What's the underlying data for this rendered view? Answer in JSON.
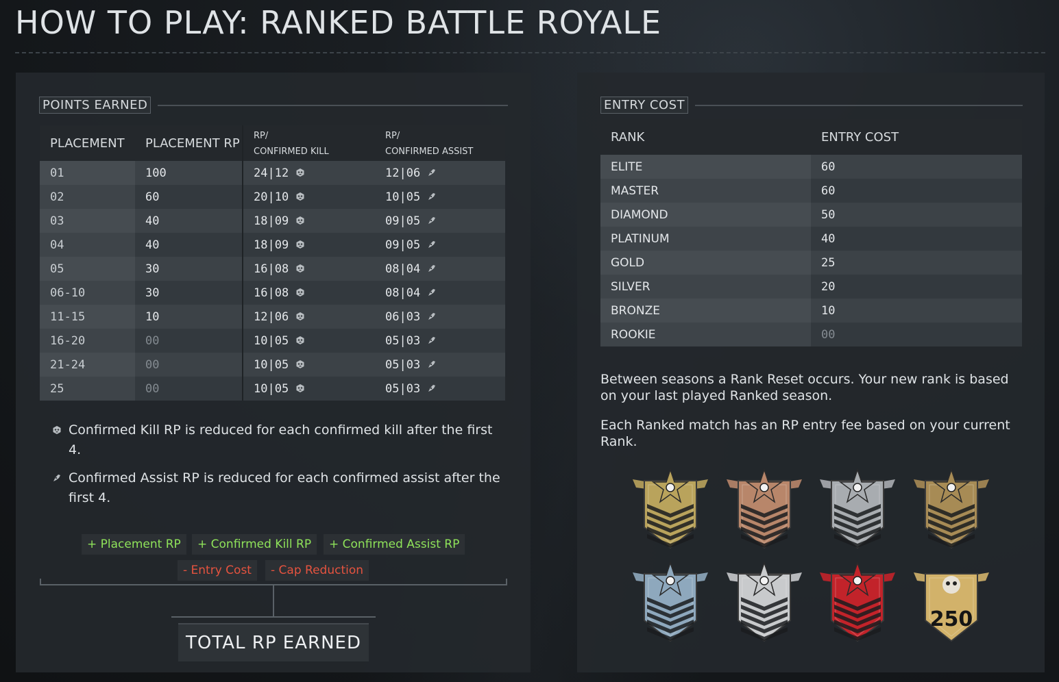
{
  "title": "HOW TO PLAY: RANKED BATTLE ROYALE",
  "points": {
    "section_label": "POINTS EARNED",
    "headers": {
      "placement": "PLACEMENT",
      "placement_rp": "PLACEMENT RP",
      "kill_top": "RP/",
      "kill_bottom": "CONFIRMED KILL",
      "assist_top": "RP/",
      "assist_bottom": "CONFIRMED ASSIST"
    },
    "rows": [
      {
        "placement": "01",
        "rp": "100",
        "kill": "24|12",
        "assist": "12|06"
      },
      {
        "placement": "02",
        "rp": "60",
        "kill": "20|10",
        "assist": "10|05"
      },
      {
        "placement": "03",
        "rp": "40",
        "kill": "18|09",
        "assist": "09|05"
      },
      {
        "placement": "04",
        "rp": "40",
        "kill": "18|09",
        "assist": "09|05"
      },
      {
        "placement": "05",
        "rp": "30",
        "kill": "16|08",
        "assist": "08|04"
      },
      {
        "placement": "06-10",
        "rp": "30",
        "kill": "16|08",
        "assist": "08|04"
      },
      {
        "placement": "11-15",
        "rp": "10",
        "kill": "12|06",
        "assist": "06|03"
      },
      {
        "placement": "16-20",
        "rp": "00",
        "kill": "10|05",
        "assist": "05|03"
      },
      {
        "placement": "21-24",
        "rp": "00",
        "kill": "10|05",
        "assist": "05|03"
      },
      {
        "placement": "25",
        "rp": "00",
        "kill": "10|05",
        "assist": "05|03"
      }
    ],
    "note_kill": "Confirmed Kill RP is reduced for each confirmed kill after the first 4.",
    "note_assist": "Confirmed Assist RP is reduced for each confirmed assist after the first 4.",
    "plus_placement": "+ Placement RP",
    "plus_kill": "+ Confirmed Kill RP",
    "plus_assist": "+ Confirmed Assist RP",
    "minus_entry": "- Entry Cost",
    "minus_cap": "- Cap Reduction",
    "total_label": "TOTAL RP EARNED"
  },
  "entry": {
    "section_label": "ENTRY COST",
    "headers": {
      "rank": "RANK",
      "cost": "ENTRY COST"
    },
    "rows": [
      {
        "rank": "ELITE",
        "cost": "60"
      },
      {
        "rank": "MASTER",
        "cost": "60"
      },
      {
        "rank": "DIAMOND",
        "cost": "50"
      },
      {
        "rank": "PLATINUM",
        "cost": "40"
      },
      {
        "rank": "GOLD",
        "cost": "25"
      },
      {
        "rank": "SILVER",
        "cost": "20"
      },
      {
        "rank": "BRONZE",
        "cost": "10"
      },
      {
        "rank": "ROOKIE",
        "cost": "00"
      }
    ],
    "para1": "Between seasons a Rank Reset occurs. Your new rank is based on your last played Ranked season.",
    "para2": "Each Ranked match has an RP entry fee based on your current Rank.",
    "badges": [
      {
        "icon": "gold-chevron-rank-badge",
        "color": "#b9a35c"
      },
      {
        "icon": "bronze-chevron-rank-badge",
        "color": "#b8866a"
      },
      {
        "icon": "silver-chevron-rank-badge",
        "color": "#a8acb0"
      },
      {
        "icon": "gold-brown-chevron-rank-badge",
        "color": "#a78b55"
      },
      {
        "icon": "diamond-chevron-rank-badge",
        "color": "#8ea8bd"
      },
      {
        "icon": "platinum-chevron-rank-badge",
        "color": "#c8cacc"
      },
      {
        "icon": "red-chevron-rank-badge",
        "color": "#c2232a"
      },
      {
        "icon": "skull-250-rank-badge",
        "color": "#d2b26a",
        "number": "250"
      }
    ]
  },
  "colors": {
    "plus": "#8fe35a",
    "minus": "#e5533f"
  }
}
